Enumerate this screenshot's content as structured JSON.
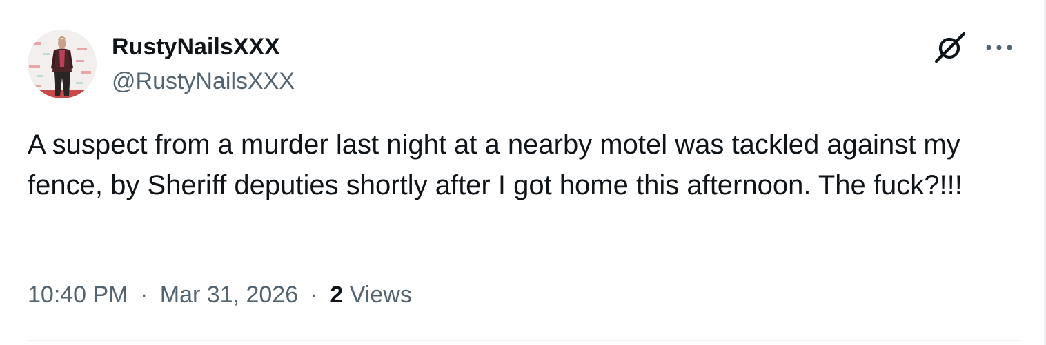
{
  "author": {
    "display_name": "RustyNailsXXX",
    "handle": "@RustyNailsXXX"
  },
  "icons": {
    "grok": "grok-icon",
    "more": "more-options-icon"
  },
  "tweet": {
    "text": "A suspect from a murder last night at a nearby motel was tackled against my fence, by Sheriff deputies shortly after I got home this afternoon. The fuck?!!!"
  },
  "meta": {
    "time": "10:40 PM",
    "separator": "·",
    "date": "Mar 31, 2026",
    "views_count": "2",
    "views_label": "Views"
  },
  "colors": {
    "primary_text": "#0f1419",
    "secondary_text": "#536471",
    "divider": "#eff3f4"
  }
}
